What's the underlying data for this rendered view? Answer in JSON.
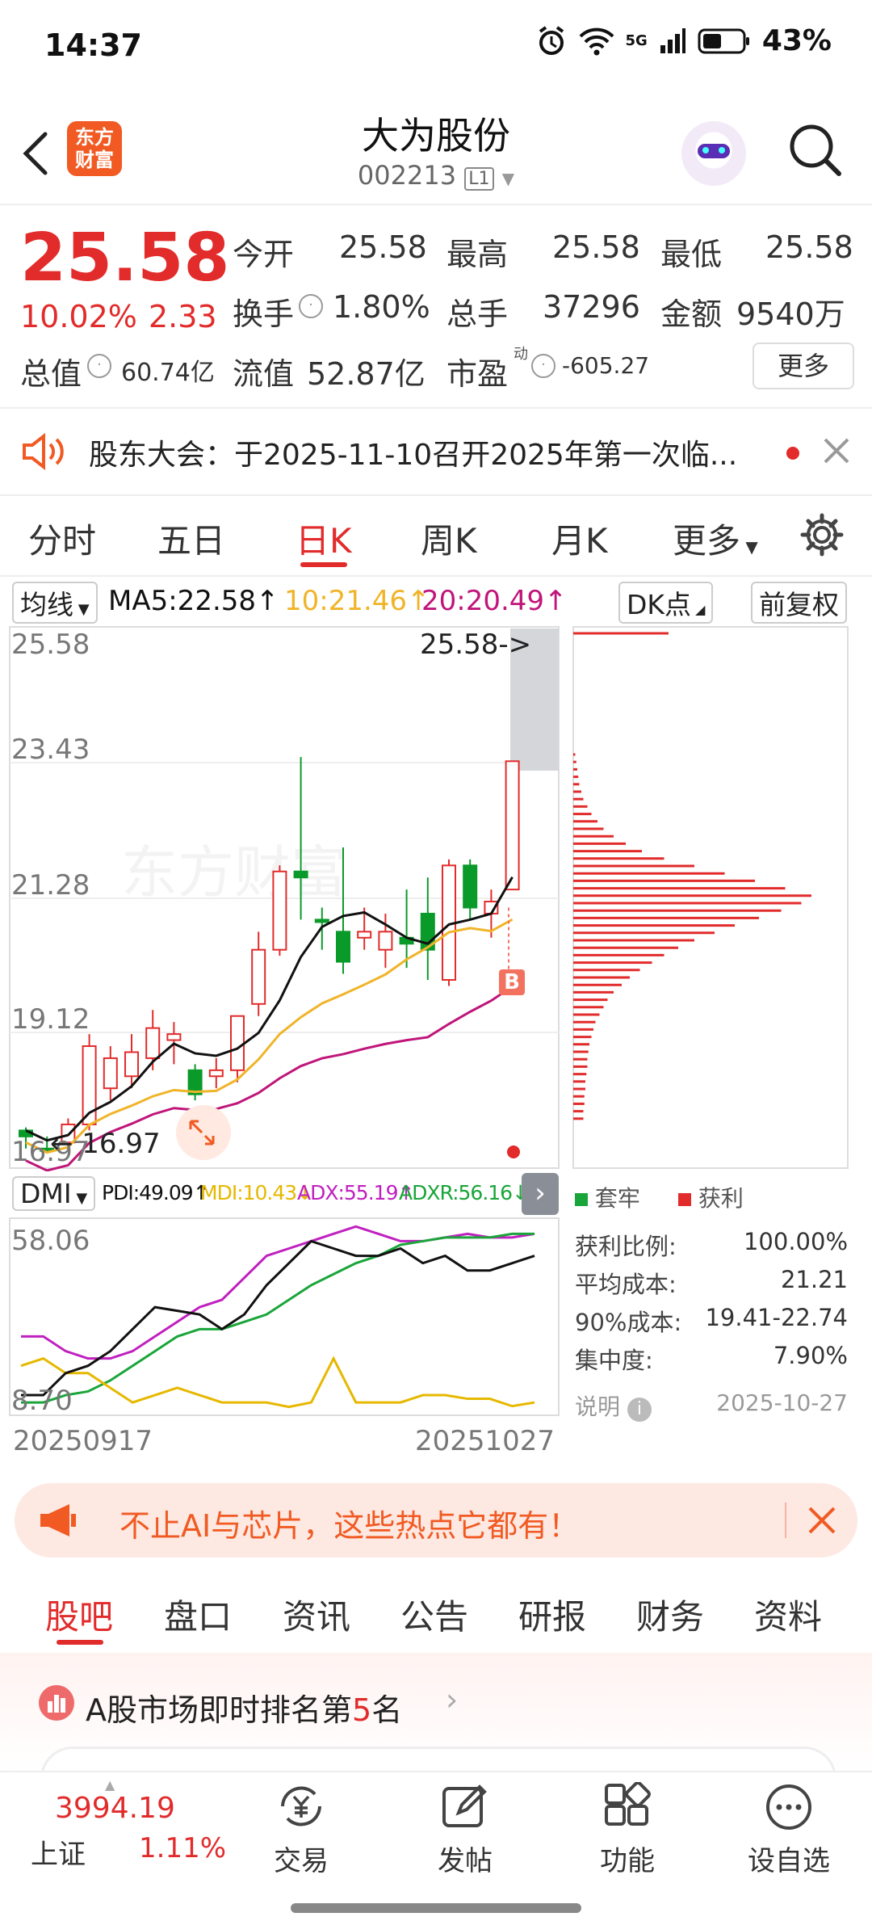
{
  "status_bar": {
    "time": "14:37",
    "network": "5G",
    "battery": "43%"
  },
  "header": {
    "logo_text_1": "东方",
    "logo_text_2": "财富",
    "title": "大为股份",
    "code": "002213",
    "level": "L1"
  },
  "quote": {
    "price": "25.58",
    "change_pct": "10.02%",
    "change": "2.33",
    "open_label": "今开",
    "open": "25.58",
    "high_label": "最高",
    "high": "25.58",
    "low_label": "最低",
    "low": "25.58",
    "turnover_label": "换手",
    "turnover": "1.80%",
    "volume_label": "总手",
    "volume": "37296",
    "amount_label": "金额",
    "amount": "9540万",
    "mktcap_label": "总值",
    "mktcap": "60.74亿",
    "float_label": "流值",
    "float": "52.87亿",
    "pe_label": "市盈",
    "pe_sup": "动",
    "pe": "-605.27",
    "more": "更多"
  },
  "notice": {
    "text": "股东大会：于2025-11-10召开2025年第一次临..."
  },
  "chart_tabs": [
    "分时",
    "五日",
    "日K",
    "周K",
    "月K",
    "更多"
  ],
  "active_chart_tab": "日K",
  "ma_bar": {
    "selector": "均线",
    "ma5": "MA5:22.58↑",
    "ma10": "10:21.46↑",
    "ma20": "20:20.49↑",
    "dk": "DK点",
    "adjust": "前复权"
  },
  "kline": {
    "price_labels": [
      "25.58",
      "23.43",
      "21.28",
      "19.12",
      "16.97"
    ],
    "last_price_label": "25.58->",
    "low_label": "16.97",
    "buy_marker": "B"
  },
  "dmi": {
    "selector": "DMI",
    "pdi": "PDI:49.09↑",
    "mdi": "MDI:10.43↓",
    "adx": "ADX:55.19↑",
    "adxr": "ADXR:56.16↓",
    "high_label": "58.06",
    "low_label": "8.70",
    "start_date": "20250917",
    "end_date": "20251027"
  },
  "chip_panel": {
    "legend_trapped": "套牢",
    "legend_profit": "获利",
    "rows": [
      {
        "label": "获利比例:",
        "value": "100.00%"
      },
      {
        "label": "平均成本:",
        "value": "21.21"
      },
      {
        "label": "90%成本:",
        "value": "19.41-22.74"
      },
      {
        "label": "集中度:",
        "value": "7.90%"
      }
    ],
    "note": "说明",
    "date": "2025-10-27"
  },
  "banner": {
    "text": "不止AI与芯片，这些热点它都有！"
  },
  "content_tabs": [
    "股吧",
    "盘口",
    "资讯",
    "公告",
    "研报",
    "财务",
    "资料"
  ],
  "active_content_tab": "股吧",
  "rank": {
    "prefix": "A股市场即时排名第",
    "number": "5",
    "suffix": "名"
  },
  "bottom_nav": {
    "index_value": "3994.19",
    "index_name": "上证",
    "index_change": "1.11%",
    "items": [
      "交易",
      "发帖",
      "功能",
      "设自选"
    ]
  },
  "colors": {
    "up": "#e22b2b",
    "down": "#0a9a2a",
    "ma5": "#111111",
    "ma10": "#f0b429",
    "ma20": "#c0157a",
    "accent": "#f15a22"
  }
}
